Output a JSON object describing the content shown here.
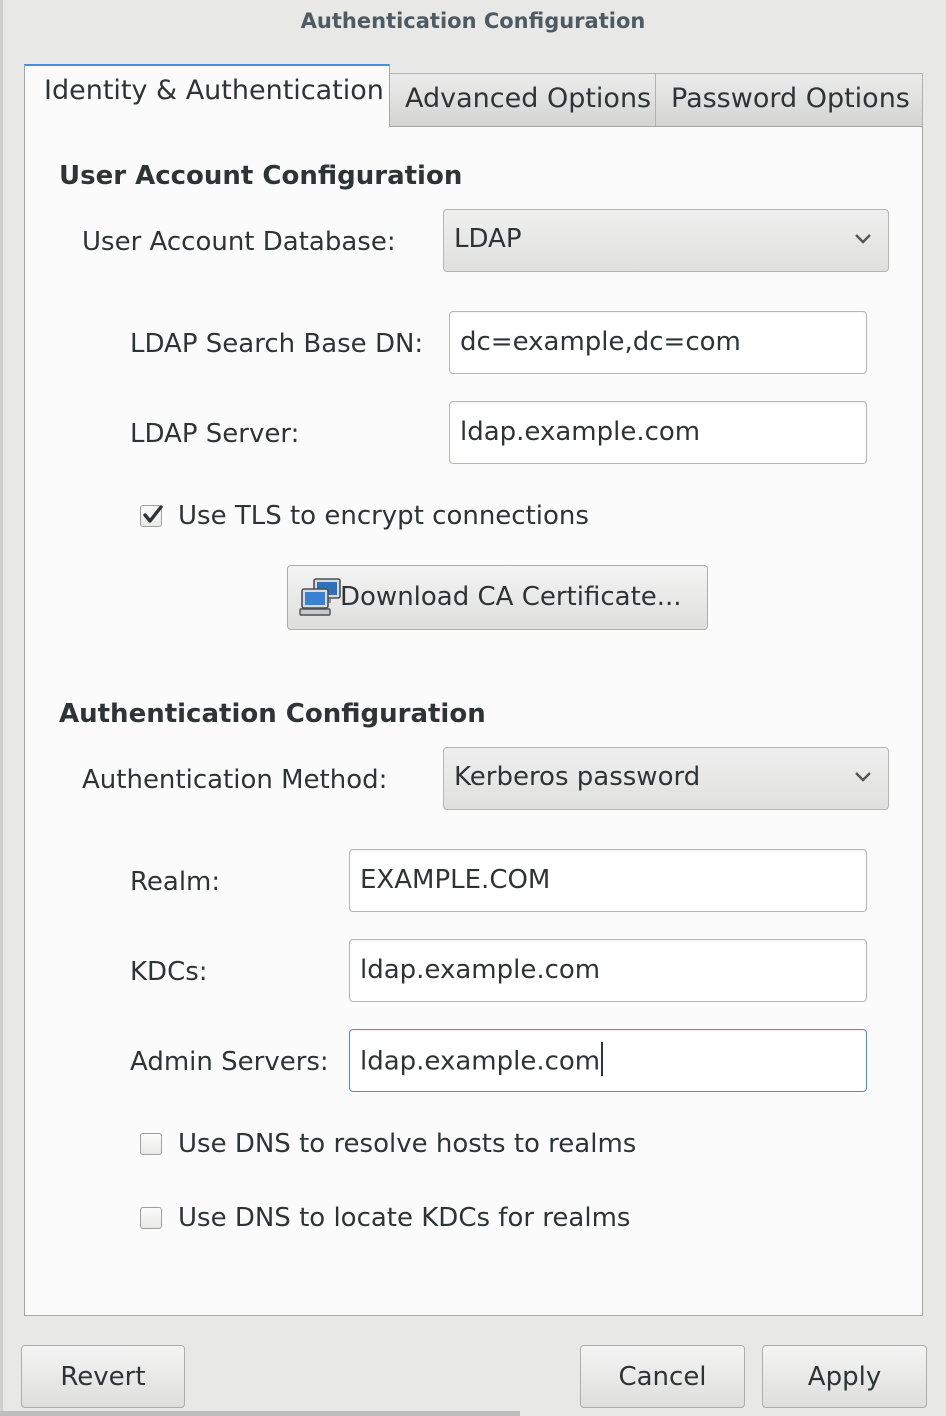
{
  "window": {
    "title": "Authentication Configuration"
  },
  "tabs": [
    {
      "label": "Identity & Authentication",
      "active": true
    },
    {
      "label": "Advanced Options",
      "active": false
    },
    {
      "label": "Password Options",
      "active": false
    }
  ],
  "user_account": {
    "section_title": "User Account Configuration",
    "database_label": "User Account Database:",
    "database_value": "LDAP",
    "search_base_label": "LDAP Search Base DN:",
    "search_base_value": "dc=example,dc=com",
    "server_label": "LDAP Server:",
    "server_value": "ldap.example.com",
    "tls_label": "Use TLS to encrypt connections",
    "tls_checked": true,
    "download_ca_label": "Download CA Certificate..."
  },
  "authentication": {
    "section_title": "Authentication Configuration",
    "method_label": "Authentication Method:",
    "method_value": "Kerberos password",
    "realm_label": "Realm:",
    "realm_value": "EXAMPLE.COM",
    "kdcs_label": "KDCs:",
    "kdcs_value": "ldap.example.com",
    "admin_servers_label": "Admin Servers:",
    "admin_servers_value": "ldap.example.com",
    "dns_hosts_label": "Use DNS to resolve hosts to realms",
    "dns_hosts_checked": false,
    "dns_kdcs_label": "Use DNS to locate KDCs for realms",
    "dns_kdcs_checked": false
  },
  "footer": {
    "revert_label": "Revert",
    "cancel_label": "Cancel",
    "apply_label": "Apply"
  },
  "colors": {
    "window_bg": "#e8e8e7",
    "panel_bg": "#fbfbfb",
    "focus_accent": "#4a90d9",
    "text": "#2e3436"
  },
  "icons": {
    "combo_arrow": "chevron-down-icon",
    "tls_check": "check-mark-icon",
    "download_button": "network-computers-icon"
  }
}
